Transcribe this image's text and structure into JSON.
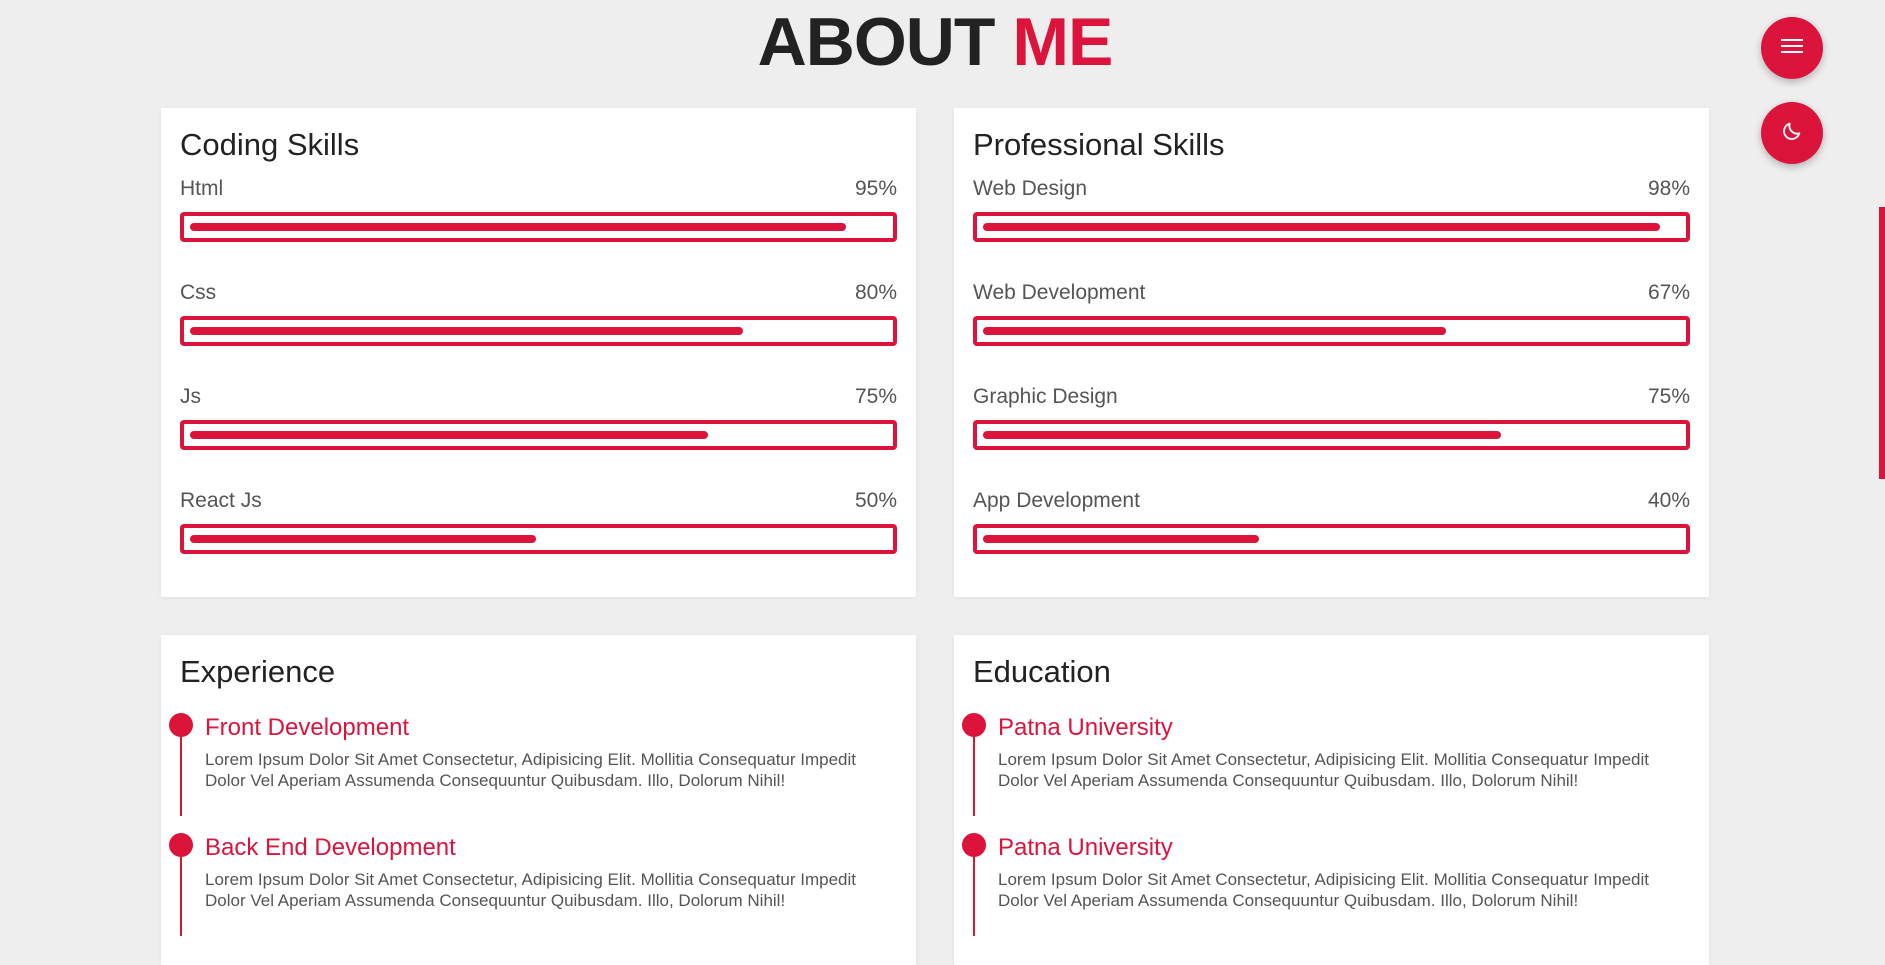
{
  "heading": {
    "part1": "ABOUT",
    "part2": "ME"
  },
  "colors": {
    "accent": "#dc143c",
    "background": "#eeeeee",
    "card": "#ffffff"
  },
  "coding_skills": {
    "title": "Coding Skills",
    "items": [
      {
        "label": "Html",
        "percent": "95%",
        "value": 95
      },
      {
        "label": "Css",
        "percent": "80%",
        "value": 80
      },
      {
        "label": "Js",
        "percent": "75%",
        "value": 75
      },
      {
        "label": "React Js",
        "percent": "50%",
        "value": 50
      }
    ]
  },
  "professional_skills": {
    "title": "Professional Skills",
    "items": [
      {
        "label": "Web Design",
        "percent": "98%",
        "value": 98
      },
      {
        "label": "Web Development",
        "percent": "67%",
        "value": 67
      },
      {
        "label": "Graphic Design",
        "percent": "75%",
        "value": 75
      },
      {
        "label": "App Development",
        "percent": "40%",
        "value": 40
      }
    ]
  },
  "experience": {
    "title": "Experience",
    "items": [
      {
        "title": "Front Development",
        "text": "Lorem Ipsum Dolor Sit Amet Consectetur, Adipisicing Elit. Mollitia Consequatur Impedit Dolor Vel Aperiam Assumenda Consequuntur Quibusdam. Illo, Dolorum Nihil!"
      },
      {
        "title": "Back End Development",
        "text": "Lorem Ipsum Dolor Sit Amet Consectetur, Adipisicing Elit. Mollitia Consequatur Impedit Dolor Vel Aperiam Assumenda Consequuntur Quibusdam. Illo, Dolorum Nihil!"
      }
    ]
  },
  "education": {
    "title": "Education",
    "items": [
      {
        "title": "Patna University",
        "text": "Lorem Ipsum Dolor Sit Amet Consectetur, Adipisicing Elit. Mollitia Consequatur Impedit Dolor Vel Aperiam Assumenda Consequuntur Quibusdam. Illo, Dolorum Nihil!"
      },
      {
        "title": "Patna University",
        "text": "Lorem Ipsum Dolor Sit Amet Consectetur, Adipisicing Elit. Mollitia Consequatur Impedit Dolor Vel Aperiam Assumenda Consequuntur Quibusdam. Illo, Dolorum Nihil!"
      }
    ]
  },
  "controls": {
    "menu_icon": "hamburger-menu-icon",
    "theme_icon": "moon-icon"
  }
}
